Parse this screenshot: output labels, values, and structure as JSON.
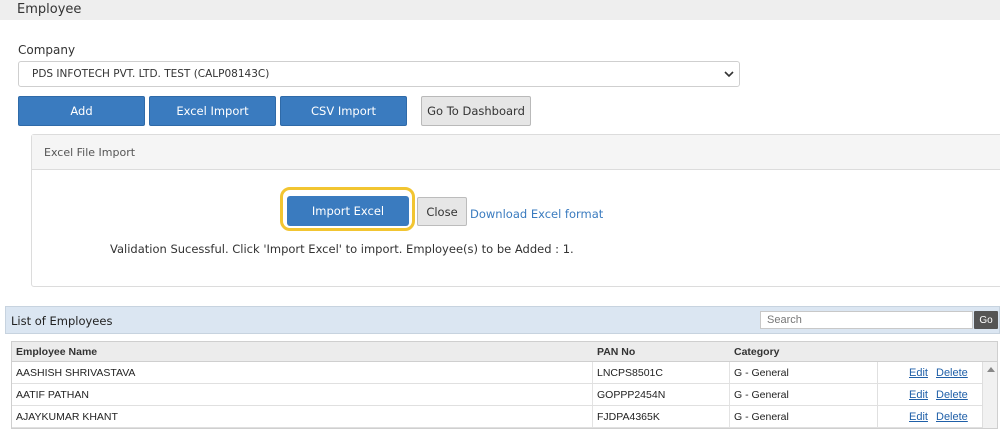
{
  "header": {
    "title": "Employee"
  },
  "company": {
    "label": "Company",
    "selected": "PDS INFOTECH PVT. LTD. TEST (CALP08143C)"
  },
  "toolbar": {
    "add_label": "Add",
    "excel_import_label": "Excel Import",
    "csv_import_label": "CSV Import",
    "dashboard_label": "Go To Dashboard"
  },
  "import_panel": {
    "title": "Excel File Import",
    "import_label": "Import Excel",
    "close_label": "Close",
    "download_label": "Download Excel format",
    "message": "Validation Sucessful. Click 'Import Excel' to import. Employee(s) to be Added : 1."
  },
  "employees": {
    "title": "List of Employees",
    "search_placeholder": "Search",
    "go_label": "Go",
    "columns": [
      "Employee Name",
      "PAN No",
      "Category"
    ],
    "edit_label": "Edit",
    "delete_label": "Delete",
    "rows": [
      {
        "name": "AASHISH SHRIVASTAVA",
        "pan": "LNCPS8501C",
        "category": "G - General"
      },
      {
        "name": "AATIF PATHAN",
        "pan": "GOPPP2454N",
        "category": "G - General"
      },
      {
        "name": "AJAYKUMAR KHANT",
        "pan": "FJDPA4365K",
        "category": "G - General"
      }
    ]
  },
  "colors": {
    "primary": "#3a7bbf",
    "highlight": "#f2c531",
    "list_header_bg": "#dbe6f2"
  }
}
